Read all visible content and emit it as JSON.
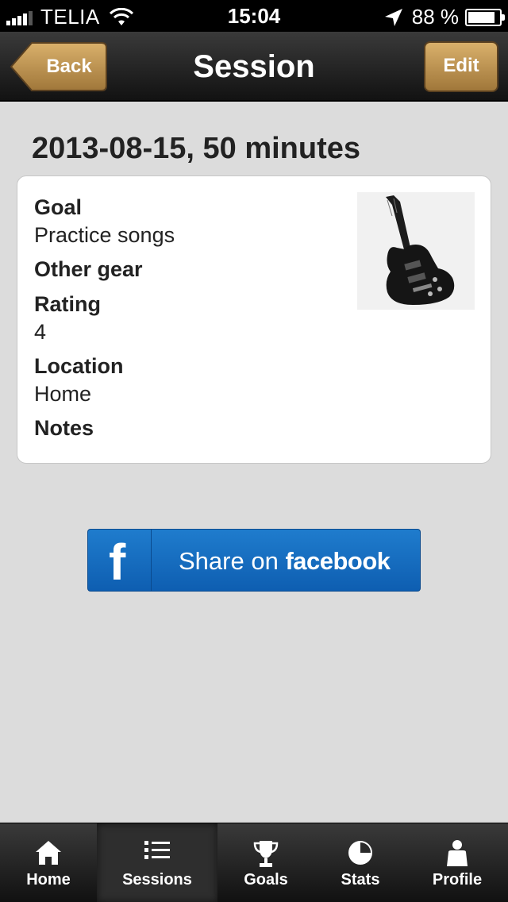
{
  "status_bar": {
    "carrier": "TELIA",
    "time": "15:04",
    "battery": "88 %",
    "battery_level": 0.88
  },
  "nav": {
    "back_label": "Back",
    "title": "Session",
    "edit_label": "Edit"
  },
  "session": {
    "title": "2013-08-15, 50 minutes",
    "fields": {
      "goal_label": "Goal",
      "goal_value": "Practice songs",
      "gear_label": "Other gear",
      "rating_label": "Rating",
      "rating_value": "4",
      "location_label": "Location",
      "location_value": "Home",
      "notes_label": "Notes"
    },
    "image_icon": "guitar-photo"
  },
  "share": {
    "prefix": "Share on",
    "brand": "facebook",
    "logo_letter": "f"
  },
  "tabs": [
    {
      "label": "Home",
      "icon": "home-icon"
    },
    {
      "label": "Sessions",
      "icon": "list-icon"
    },
    {
      "label": "Goals",
      "icon": "trophy-icon"
    },
    {
      "label": "Stats",
      "icon": "pie-chart-icon"
    },
    {
      "label": "Profile",
      "icon": "person-icon"
    }
  ],
  "colors": {
    "accent_gold": "#c49a55",
    "facebook_blue": "#1a6fc4"
  }
}
